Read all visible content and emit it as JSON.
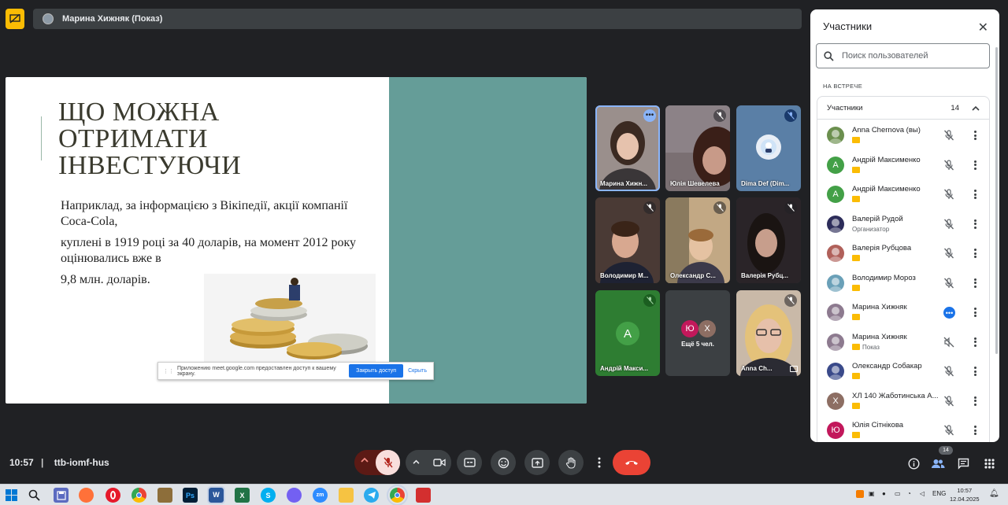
{
  "header": {
    "presenter_title": "Марина Хижняк (Показ)"
  },
  "slide": {
    "title": "ЩО МОЖНА\nОТРИМАТИ\nІНВЕСТУЮЧИ",
    "paragraphs": [
      "Наприклад, за інформацією з Вікіпедії, акції компанії Coca-Cola,",
      "куплені в 1919 році за 40 доларів, на момент 2012 року оцінювались вже в",
      "9,8 млн. доларів."
    ],
    "share_bar": {
      "message": "Приложению meet.google.com предоставлен доступ к вашему экрану.",
      "stop_label": "Закрыть доступ",
      "hide_label": "Скрыть"
    }
  },
  "tiles": [
    {
      "name": "Марина Хижн..."
    },
    {
      "name": "Юлія Шевелева"
    },
    {
      "name": "Dima Def (Dim..."
    },
    {
      "name": "Володимир М..."
    },
    {
      "name": "Олександр С..."
    },
    {
      "name": "Валерія Рубц..."
    },
    {
      "name": "Андрій Макси...",
      "initial": "А"
    },
    {
      "name": "Ещё 5 чел.",
      "initials": [
        "Ю",
        "Х"
      ]
    },
    {
      "name": "Anna Ch..."
    }
  ],
  "people_panel": {
    "title": "Участники",
    "search_placeholder": "Поиск пользователей",
    "section_label": "НА ВСТРЕЧЕ",
    "group_label": "Участники",
    "group_count": "14",
    "participants": [
      {
        "name": "Anna Chernova (вы)",
        "sub": "",
        "avatar": "photo",
        "color": "#6b8f4e",
        "mic": "muted"
      },
      {
        "name": "Андрій Максименко",
        "sub": "",
        "avatar": "А",
        "color": "#43a047",
        "mic": "muted"
      },
      {
        "name": "Андрій Максименко",
        "sub": "",
        "avatar": "А",
        "color": "#43a047",
        "mic": "muted"
      },
      {
        "name": "Валерій Рудой",
        "sub": "Организатор",
        "avatar": "photo",
        "color": "#2d2d5a",
        "mic": "muted"
      },
      {
        "name": "Валерія Рубцова",
        "sub": "",
        "avatar": "photo",
        "color": "#b0605a",
        "mic": "muted"
      },
      {
        "name": "Володимир Мороз",
        "sub": "",
        "avatar": "photo",
        "color": "#6aa0b8",
        "mic": "muted"
      },
      {
        "name": "Марина Хижняк",
        "sub": "",
        "avatar": "photo",
        "color": "#8d7a8f",
        "mic": "speaking"
      },
      {
        "name": "Марина Хижняк",
        "sub": "Показ",
        "avatar": "photo",
        "color": "#8d7a8f",
        "mic": "off"
      },
      {
        "name": "Олександр Собакар",
        "sub": "",
        "avatar": "photo",
        "color": "#3a4a8a",
        "mic": "muted"
      },
      {
        "name": "ХЛ 140 Жаботинська А...",
        "sub": "",
        "avatar": "Х",
        "color": "#8d6e63",
        "mic": "muted"
      },
      {
        "name": "Юлія Сітнікова",
        "sub": "",
        "avatar": "Ю",
        "color": "#c2185b",
        "mic": "muted"
      }
    ]
  },
  "footer": {
    "time": "10:57",
    "meeting_code": "ttb-iomf-hus",
    "people_count": "14"
  },
  "taskbar": {
    "lang": "ENG",
    "clock_time": "10:57",
    "clock_date": "12.04.2025",
    "app_labels": {
      "photoshop": "Ps",
      "word": "W",
      "excel": "X",
      "zoom": "zm",
      "skype": "S"
    }
  },
  "colors": {
    "background": "#202124",
    "accent_yellow": "#fbbc04",
    "hangup_red": "#ea4335",
    "slide_teal": "#659d98",
    "active_blue": "#8ab4f8"
  }
}
